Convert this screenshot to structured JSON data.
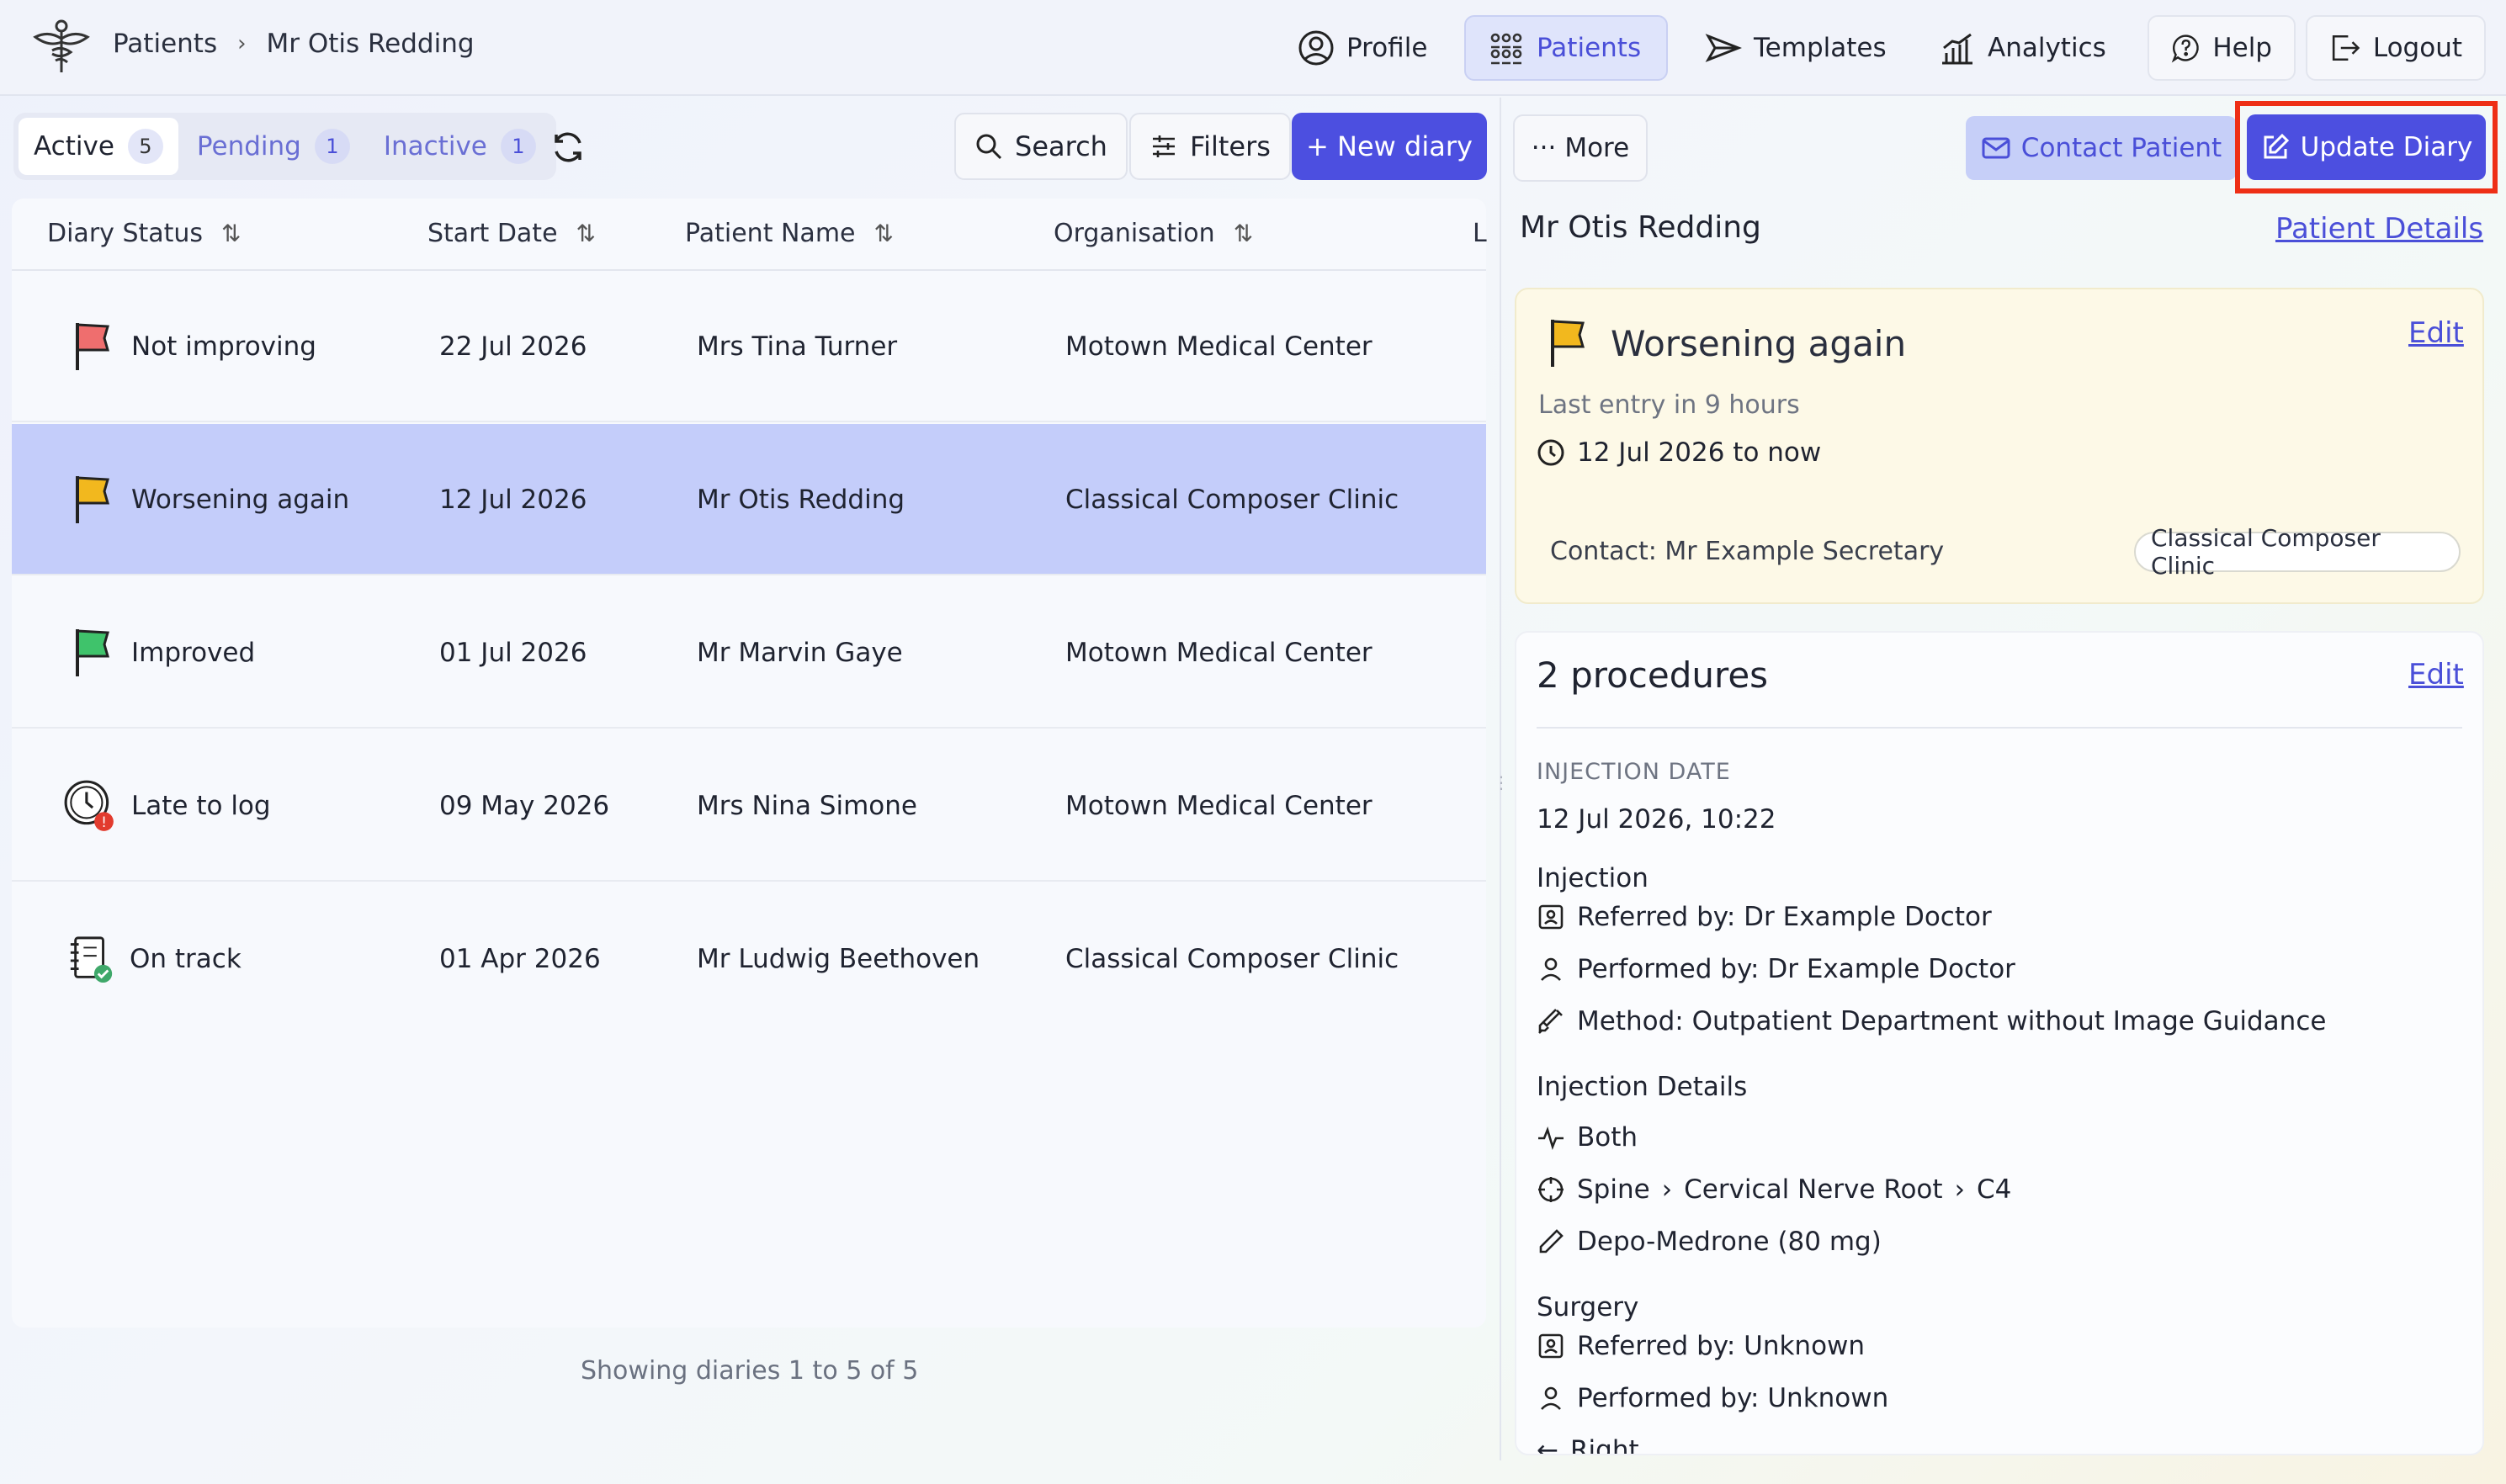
{
  "breadcrumb": {
    "root": "Patients",
    "current": "Mr Otis Redding"
  },
  "nav": {
    "profile": "Profile",
    "patients": "Patients",
    "templates": "Templates",
    "analytics": "Analytics",
    "help": "Help",
    "logout": "Logout"
  },
  "tabs": [
    {
      "label": "Active",
      "count": "5"
    },
    {
      "label": "Pending",
      "count": "1"
    },
    {
      "label": "Inactive",
      "count": "1"
    }
  ],
  "toolbar": {
    "search": "Search",
    "filters": "Filters",
    "new_diary": "+ New diary"
  },
  "table": {
    "columns": [
      "Diary Status",
      "Start Date",
      "Patient Name",
      "Organisation",
      "L"
    ],
    "rows": [
      {
        "status": "Not improving",
        "status_icon": "red-flag-icon",
        "date": "22 Jul 2026",
        "patient": "Mrs Tina Turner",
        "org": "Motown Medical Center"
      },
      {
        "status": "Worsening again",
        "status_icon": "yellow-flag-icon",
        "date": "12 Jul 2026",
        "patient": "Mr Otis Redding",
        "org": "Classical Composer Clinic"
      },
      {
        "status": "Improved",
        "status_icon": "green-flag-icon",
        "date": "01 Jul 2026",
        "patient": "Mr Marvin Gaye",
        "org": "Motown Medical Center"
      },
      {
        "status": "Late to log",
        "status_icon": "late-clock-icon",
        "date": "09 May 2026",
        "patient": "Mrs Nina Simone",
        "org": "Motown Medical Center"
      },
      {
        "status": "On track",
        "status_icon": "on-track-notebook-icon",
        "date": "01 Apr 2026",
        "patient": "Mr Ludwig Beethoven",
        "org": "Classical Composer Clinic"
      }
    ],
    "footer": "Showing diaries 1 to 5 of 5"
  },
  "detail": {
    "more": "More",
    "contact_patient": "Contact Patient",
    "update_diary": "Update Diary",
    "patient_name": "Mr Otis Redding",
    "patient_details_link": "Patient Details",
    "status_card": {
      "title": "Worsening again",
      "edit": "Edit",
      "last_entry": "Last entry in 9 hours",
      "range": "12 Jul 2026 to now",
      "contact": "Contact: Mr Example Secretary",
      "clinic": "Classical Composer Clinic"
    },
    "procedures": {
      "title": "2 procedures",
      "edit": "Edit",
      "injection_date_label": "INJECTION DATE",
      "injection_date": "12 Jul 2026, 10:22",
      "injection_heading": "Injection",
      "referred_by": "Referred by: Dr Example Doctor",
      "performed_by": "Performed by: Dr Example Doctor",
      "method": "Method: Outpatient Department without Image Guidance",
      "details_heading": "Injection Details",
      "side": "Both",
      "location_1": "Spine",
      "location_2": "Cervical Nerve Root",
      "location_3": "C4",
      "drug": "Depo-Medrone (80 mg)",
      "surgery_heading": "Surgery",
      "surgery_referred_by": "Referred by: Unknown",
      "surgery_performed_by": "Performed by: Unknown",
      "surgery_side": "Right"
    }
  },
  "colors": {
    "accent": "#4c4fe0",
    "selected_row": "#c4cdfa",
    "highlight_border": "#ee2f16",
    "status_card_bg": "#fdf9e7"
  }
}
